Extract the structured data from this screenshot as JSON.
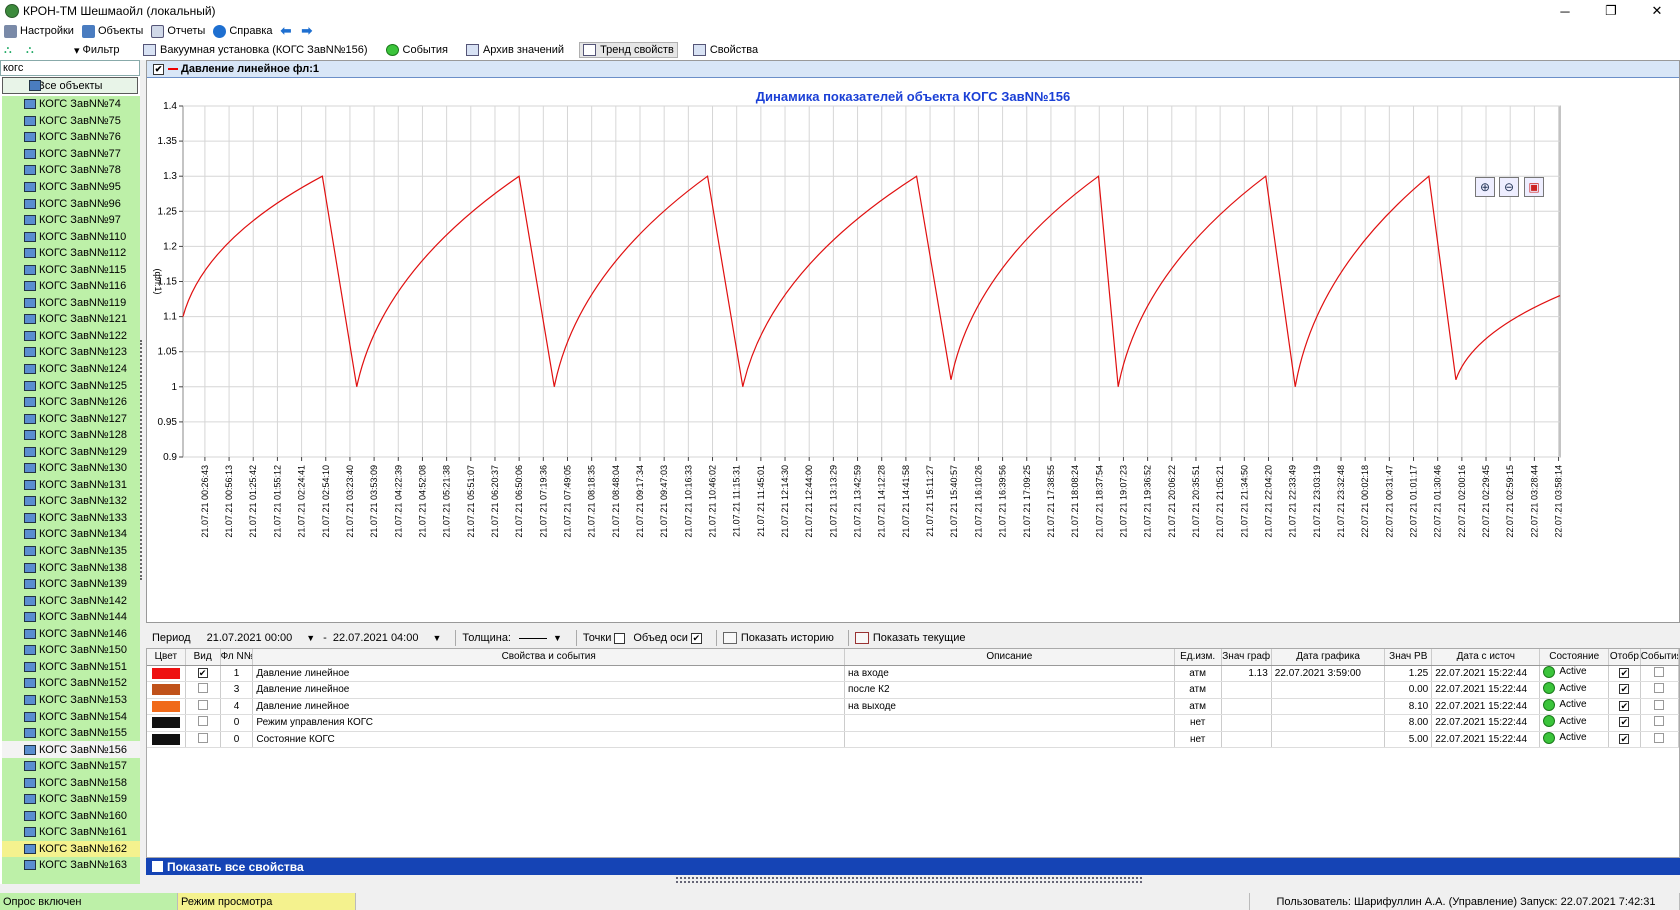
{
  "window": {
    "title": "КРОН-ТМ Шешмаойл (локальный)",
    "controls": [
      "─",
      "❐",
      "✕"
    ]
  },
  "menu": {
    "items": [
      {
        "label": "Настройки",
        "icon": "settings-icon"
      },
      {
        "label": "Объекты",
        "icon": "objects-icon"
      },
      {
        "label": "Отчеты",
        "icon": "reports-icon"
      },
      {
        "label": "Справка",
        "icon": "help-icon"
      }
    ],
    "back": "⬅",
    "forward": "➡"
  },
  "toolbar": {
    "filter": "Фильтр",
    "vacuum": "Вакуумная установка (КОГС ЗавN№156)",
    "events": "События",
    "archive": "Архив значений",
    "trend": "Тренд свойств",
    "props": "Свойства"
  },
  "sidebar": {
    "search": "когс",
    "all_objects": "Все объекты",
    "items": [
      {
        "label": "КОГС ЗавN№74"
      },
      {
        "label": "КОГС ЗавN№75"
      },
      {
        "label": "КОГС ЗавN№76"
      },
      {
        "label": "КОГС ЗавN№77"
      },
      {
        "label": "КОГС ЗавN№78"
      },
      {
        "label": "КОГС ЗавN№95"
      },
      {
        "label": "КОГС ЗавN№96"
      },
      {
        "label": "КОГС ЗавN№97"
      },
      {
        "label": "КОГС ЗавN№110"
      },
      {
        "label": "КОГС ЗавN№112"
      },
      {
        "label": "КОГС ЗавN№115"
      },
      {
        "label": "КОГС ЗавN№116"
      },
      {
        "label": "КОГС ЗавN№119"
      },
      {
        "label": "КОГС ЗавN№121"
      },
      {
        "label": "КОГС ЗавN№122"
      },
      {
        "label": "КОГС ЗавN№123"
      },
      {
        "label": "КОГС ЗавN№124"
      },
      {
        "label": "КОГС ЗавN№125"
      },
      {
        "label": "КОГС ЗавN№126"
      },
      {
        "label": "КОГС ЗавN№127"
      },
      {
        "label": "КОГС ЗавN№128"
      },
      {
        "label": "КОГС ЗавN№129"
      },
      {
        "label": "КОГС ЗавN№130"
      },
      {
        "label": "КОГС ЗавN№131"
      },
      {
        "label": "КОГС ЗавN№132"
      },
      {
        "label": "КОГС ЗавN№133"
      },
      {
        "label": "КОГС ЗавN№134"
      },
      {
        "label": "КОГС ЗавN№135"
      },
      {
        "label": "КОГС ЗавN№138"
      },
      {
        "label": "КОГС ЗавN№139"
      },
      {
        "label": "КОГС ЗавN№142"
      },
      {
        "label": "КОГС ЗавN№144"
      },
      {
        "label": "КОГС ЗавN№146"
      },
      {
        "label": "КОГС ЗавN№150"
      },
      {
        "label": "КОГС ЗавN№151"
      },
      {
        "label": "КОГС ЗавN№152"
      },
      {
        "label": "КОГС ЗавN№153"
      },
      {
        "label": "КОГС ЗавN№154"
      },
      {
        "label": "КОГС ЗавN№155"
      },
      {
        "label": "КОГС ЗавN№156",
        "state": "selected"
      },
      {
        "label": "КОГС ЗавN№157"
      },
      {
        "label": "КОГС ЗавN№158"
      },
      {
        "label": "КОГС ЗавN№159"
      },
      {
        "label": "КОГС ЗавN№160"
      },
      {
        "label": "КОГС ЗавN№161"
      },
      {
        "label": "КОГС ЗавN№162",
        "state": "highlight"
      },
      {
        "label": "КОГС ЗавN№163"
      }
    ]
  },
  "chart_tab": {
    "label": "Давление линейное фл:1"
  },
  "chart_data": {
    "type": "line",
    "title": "Динамика показателей объекта КОГС ЗавN№156",
    "ylabel": "(фл:1)",
    "ylim": [
      0.9,
      1.4
    ],
    "yticks": [
      "0.9",
      "0.95",
      "1",
      "1.05",
      "1.1",
      "1.15",
      "1.2",
      "1.25",
      "1.3",
      "1.35",
      "1.4"
    ],
    "xticks": [
      "21.07.21 00:26:43",
      "21.07.21 00:56:13",
      "21.07.21 01:25:42",
      "21.07.21 01:55:12",
      "21.07.21 02:24:41",
      "21.07.21 02:54:10",
      "21.07.21 03:23:40",
      "21.07.21 03:53:09",
      "21.07.21 04:22:39",
      "21.07.21 04:52:08",
      "21.07.21 05:21:38",
      "21.07.21 05:51:07",
      "21.07.21 06:20:37",
      "21.07.21 06:50:06",
      "21.07.21 07:19:36",
      "21.07.21 07:49:05",
      "21.07.21 08:18:35",
      "21.07.21 08:48:04",
      "21.07.21 09:17:34",
      "21.07.21 09:47:03",
      "21.07.21 10:16:33",
      "21.07.21 10:46:02",
      "21.07.21 11:15:31",
      "21.07.21 11:45:01",
      "21.07.21 12:14:30",
      "21.07.21 12:44:00",
      "21.07.21 13:13:29",
      "21.07.21 13:42:59",
      "21.07.21 14:12:28",
      "21.07.21 14:41:58",
      "21.07.21 15:11:27",
      "21.07.21 15:40:57",
      "21.07.21 16:10:26",
      "21.07.21 16:39:56",
      "21.07.21 17:09:25",
      "21.07.21 17:38:55",
      "21.07.21 18:08:24",
      "21.07.21 18:37:54",
      "21.07.21 19:07:23",
      "21.07.21 19:36:52",
      "21.07.21 20:06:22",
      "21.07.21 20:35:51",
      "21.07.21 21:05:21",
      "21.07.21 21:34:50",
      "21.07.21 22:04:20",
      "21.07.21 22:33:49",
      "21.07.21 23:03:19",
      "21.07.21 23:32:48",
      "22.07.21 00:02:18",
      "22.07.21 00:31:47",
      "22.07.21 01:01:17",
      "22.07.21 01:30:46",
      "22.07.21 02:00:16",
      "22.07.21 02:29:45",
      "22.07.21 02:59:15",
      "22.07.21 03:28:44",
      "22.07.21 03:58:14"
    ],
    "xrange": [
      "21.07.2021 00:00",
      "22.07.2021 04:00"
    ],
    "grid": true,
    "series": [
      {
        "name": "Давление линейное фл:1",
        "color": "#e01010",
        "points": [
          [
            "21.07.21 00:00",
            1.1
          ],
          [
            "21.07.21 02:50",
            1.3
          ],
          [
            "21.07.21 03:32",
            1.0
          ],
          [
            "21.07.21 06:50",
            1.3
          ],
          [
            "21.07.21 07:33",
            1.0
          ],
          [
            "21.07.21 10:40",
            1.3
          ],
          [
            "21.07.21 11:23",
            1.0
          ],
          [
            "21.07.21 14:55",
            1.3
          ],
          [
            "21.07.21 15:37",
            1.01
          ],
          [
            "21.07.21 18:37",
            1.3
          ],
          [
            "21.07.21 19:01",
            1.0
          ],
          [
            "21.07.21 22:01",
            1.3
          ],
          [
            "21.07.21 22:37",
            1.0
          ],
          [
            "22.07.21 01:20",
            1.3
          ],
          [
            "22.07.21 01:53",
            1.01
          ],
          [
            "22.07.21 04:00",
            1.13
          ]
        ]
      }
    ]
  },
  "controls": {
    "period_label": "Период",
    "from": "21.07.2021 00:00",
    "dash": "-",
    "to": "22.07.2021 04:00",
    "thickness_label": "Толщина:",
    "points_label": "Точки",
    "merge_axes_label": "Объед оси",
    "show_history": "Показать историю",
    "show_current": "Показать текущие",
    "dropdown_arrow": "▼"
  },
  "table": {
    "headers": [
      "Цвет",
      "Вид",
      "Фл N№",
      "Свойства и события",
      "Описание",
      "Ед.изм.",
      "Знач граф",
      "Дата графика",
      "Знач РВ",
      "Дата с источ",
      "Состояние",
      "Отобр",
      "События"
    ],
    "rows": [
      {
        "color": "#ee1111",
        "vid": true,
        "fl": "1",
        "prop": "Давление линейное",
        "desc": "на входе",
        "unit": "атм",
        "val_graph": "1.13",
        "date_graph": "22.07.2021 3:59:00",
        "val_rv": "1.25",
        "date_src": "22.07.2021 15:22:44",
        "state": "Active",
        "display": true,
        "events": false
      },
      {
        "color": "#c0521a",
        "vid": false,
        "fl": "3",
        "prop": "Давление линейное",
        "desc": "после К2",
        "unit": "атм",
        "val_graph": "",
        "date_graph": "",
        "val_rv": "0.00",
        "date_src": "22.07.2021 15:22:44",
        "state": "Active",
        "display": true,
        "events": false
      },
      {
        "color": "#f06a1a",
        "vid": false,
        "fl": "4",
        "prop": "Давление линейное",
        "desc": "на выходе",
        "unit": "атм",
        "val_graph": "",
        "date_graph": "",
        "val_rv": "8.10",
        "date_src": "22.07.2021 15:22:44",
        "state": "Active",
        "display": true,
        "events": false
      },
      {
        "color": "#111111",
        "vid": false,
        "fl": "0",
        "prop": "Режим управления КОГС",
        "desc": "",
        "unit": "нет",
        "val_graph": "",
        "date_graph": "",
        "val_rv": "8.00",
        "date_src": "22.07.2021 15:22:44",
        "state": "Active",
        "display": true,
        "events": false
      },
      {
        "color": "#111111",
        "vid": false,
        "fl": "0",
        "prop": "Состояние КОГС",
        "desc": "",
        "unit": "нет",
        "val_graph": "",
        "date_graph": "",
        "val_rv": "5.00",
        "date_src": "22.07.2021 15:22:44",
        "state": "Active",
        "display": true,
        "events": false
      }
    ]
  },
  "show_all": "Показать все свойства",
  "status": {
    "poll": "Опрос включен",
    "mode": "Режим просмотра",
    "user": "Пользователь: Шарифуллин А.А. (Управление) Запуск: 22.07.2021 7:42:31",
    "mode_color": "#f4f28e",
    "poll_color": "#bdf0a8"
  }
}
